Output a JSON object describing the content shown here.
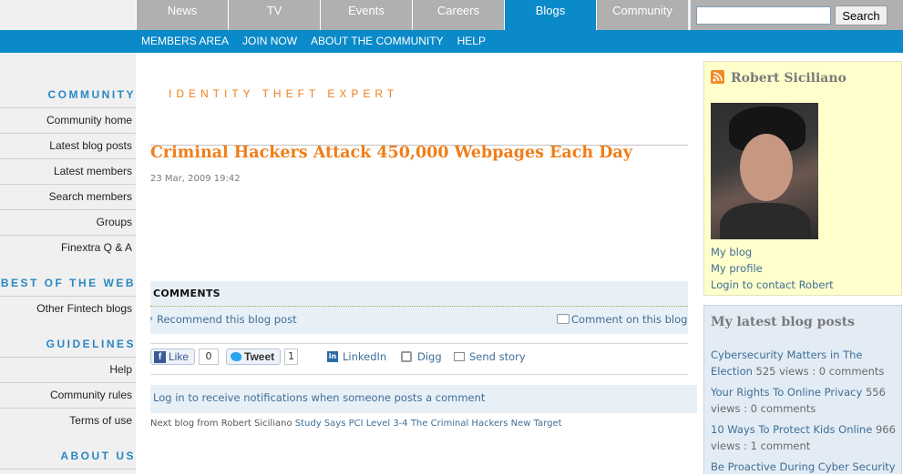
{
  "top_tabs": [
    {
      "label": "News"
    },
    {
      "label": "TV"
    },
    {
      "label": "Events"
    },
    {
      "label": "Careers"
    },
    {
      "label": "Blogs",
      "active": true
    },
    {
      "label": "Community"
    }
  ],
  "search": {
    "button_label": "Search",
    "value": ""
  },
  "subnav": [
    "MEMBERS AREA",
    "JOIN NOW",
    "ABOUT THE COMMUNITY",
    "HELP"
  ],
  "sidebar": {
    "community_heading": "COMMUNITY",
    "community_items": [
      "Community home",
      "Latest blog posts",
      "Latest members",
      "Search members",
      "Groups",
      "Finextra Q & A"
    ],
    "best_heading": "BEST OF THE WEB",
    "best_items": [
      "Other Fintech blogs"
    ],
    "guidelines_heading": "GUIDELINES",
    "guidelines_items": [
      "Help",
      "Community rules",
      "Terms of use"
    ],
    "about_heading": "ABOUT US"
  },
  "post": {
    "tagline": "IDENTITY THEFT EXPERT",
    "title": "Criminal Hackers Attack 450,000 Webpages Each Day",
    "date": "23 Mar, 2009 19:42"
  },
  "comments": {
    "heading": "COMMENTS",
    "recommend_label": "Recommend this blog post",
    "comment_label": "Comment on this blog"
  },
  "share": {
    "like_label": "Like",
    "like_count": "0",
    "tweet_label": "Tweet",
    "tweet_count": "1",
    "linkedin_label": "LinkedIn",
    "digg_label": "Digg",
    "send_label": "Send story"
  },
  "notify_text": "Log in to receive notifications when someone posts a comment",
  "next_blog": {
    "prefix": "Next blog from Robert Siciliano",
    "link": "Study Says PCI Level 3-4 The Criminal Hackers New Target"
  },
  "profile": {
    "name": "Robert Siciliano",
    "links": [
      "My blog",
      "My profile",
      "Login to contact Robert"
    ]
  },
  "latest": {
    "title": "My latest blog posts",
    "items": [
      {
        "title": "Cybersecurity Matters in The Election",
        "meta": "525 views : 0 comments"
      },
      {
        "title": "Your Rights To Online Privacy",
        "meta": "556 views : 0 comments"
      },
      {
        "title": "10 Ways To Protect Kids Online",
        "meta": "966 views : 1 comment"
      },
      {
        "title": "Be Proactive During Cyber Security",
        "meta": ""
      }
    ]
  },
  "colors": {
    "brand_blue": "#0a8ac8",
    "orange": "#f07e1a",
    "link_blue": "#3f6e96",
    "tab_gray": "#b0b0b0"
  }
}
